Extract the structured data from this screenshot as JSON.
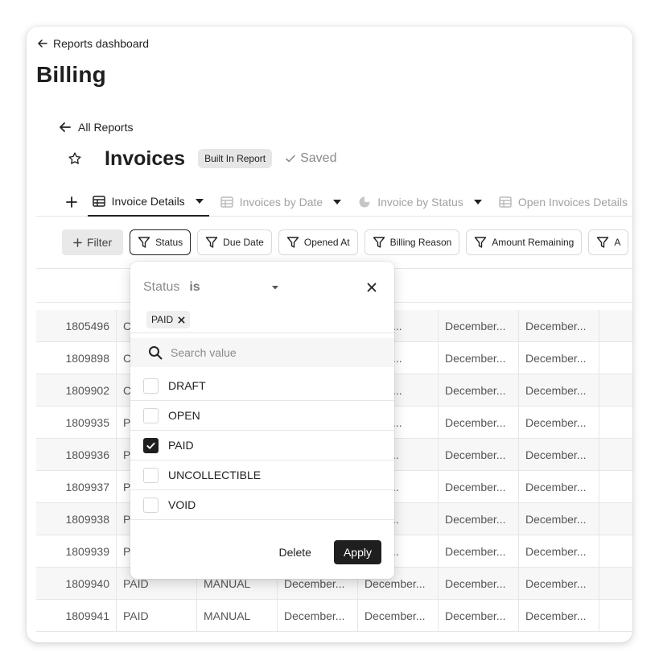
{
  "header": {
    "back_label": "Reports dashboard",
    "title": "Billing"
  },
  "report": {
    "all_reports_label": "All Reports",
    "title": "Invoices",
    "badge": "Built In Report",
    "saved_label": "Saved"
  },
  "tabs": [
    {
      "label": "Invoice Details",
      "active": true
    },
    {
      "label": "Invoices by Date",
      "active": false
    },
    {
      "label": "Invoice by Status",
      "active": false
    },
    {
      "label": "Open Invoices Details",
      "active": false
    }
  ],
  "filters": {
    "add_label": "Filter",
    "chips": [
      "Status",
      "Due Date",
      "Opened At",
      "Billing Reason",
      "Amount Remaining",
      "A"
    ]
  },
  "table": {
    "rows": [
      {
        "id": "1805496",
        "status": "C",
        "type": "",
        "c1": "",
        "c2": "ary 4,...",
        "c3": "December...",
        "c4": "December..."
      },
      {
        "id": "1809898",
        "status": "C",
        "type": "",
        "c1": "",
        "c2": "ary 5,...",
        "c3": "December...",
        "c4": "December..."
      },
      {
        "id": "1809902",
        "status": "C",
        "type": "",
        "c1": "",
        "c2": "ary 5,...",
        "c3": "December...",
        "c4": "December..."
      },
      {
        "id": "1809935",
        "status": "P",
        "type": "",
        "c1": "",
        "c2": "ary 5,...",
        "c3": "December...",
        "c4": "December..."
      },
      {
        "id": "1809936",
        "status": "P",
        "type": "",
        "c1": "",
        "c2": "mber...",
        "c3": "December...",
        "c4": "December..."
      },
      {
        "id": "1809937",
        "status": "P",
        "type": "",
        "c1": "",
        "c2": "mber...",
        "c3": "December...",
        "c4": "December..."
      },
      {
        "id": "1809938",
        "status": "P",
        "type": "",
        "c1": "",
        "c2": "mber...",
        "c3": "December...",
        "c4": "December..."
      },
      {
        "id": "1809939",
        "status": "P",
        "type": "",
        "c1": "",
        "c2": "mber...",
        "c3": "December...",
        "c4": "December..."
      },
      {
        "id": "1809940",
        "status": "PAID",
        "type": "MANUAL",
        "c1": "December...",
        "c2": "December...",
        "c3": "December...",
        "c4": "December..."
      },
      {
        "id": "1809941",
        "status": "PAID",
        "type": "MANUAL",
        "c1": "December...",
        "c2": "December...",
        "c3": "December...",
        "c4": "December..."
      }
    ]
  },
  "popover": {
    "field": "Status",
    "operator": "is",
    "tag": "PAID",
    "search_placeholder": "Search value",
    "options": [
      {
        "label": "DRAFT",
        "checked": false
      },
      {
        "label": "OPEN",
        "checked": false
      },
      {
        "label": "PAID",
        "checked": true
      },
      {
        "label": "UNCOLLECTIBLE",
        "checked": false
      },
      {
        "label": "VOID",
        "checked": false
      }
    ],
    "delete_label": "Delete",
    "apply_label": "Apply"
  }
}
